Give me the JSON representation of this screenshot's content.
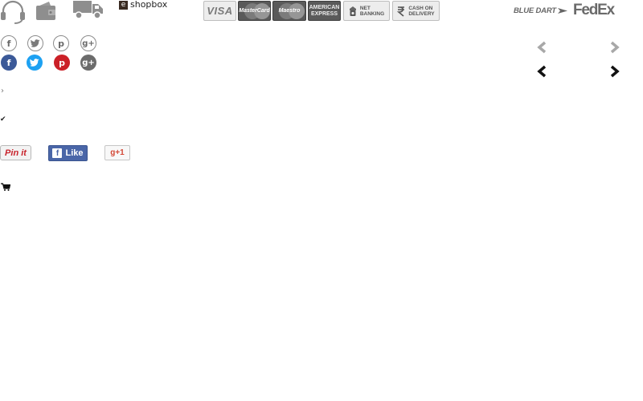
{
  "services": {
    "support_icon": "headset-icon",
    "wallet_icon": "wallet-icon",
    "delivery_icon": "delivery-truck-icon",
    "shopbox_badge": "e",
    "shopbox_label": "shopbox"
  },
  "payments": {
    "visa": "VISA",
    "mastercard": "MasterCard",
    "maestro": "Maestro",
    "amex_line1": "AMERICAN",
    "amex_line2": "EXPRESS",
    "netbanking_line1": "NET",
    "netbanking_line2": "BANKING",
    "cod_line1": "CASH ON",
    "cod_line2": "DELIVERY"
  },
  "couriers": {
    "bluedart": "BLUE DART",
    "fedex": "FedEx"
  },
  "social": {
    "facebook": "f",
    "twitter": "twitter-icon",
    "pinterest": "p",
    "googleplus": "g+",
    "colors": {
      "facebook": "#3b5998",
      "twitter": "#1da1f2",
      "pinterest": "#cb2027",
      "googleplus": "#6b6b6b"
    }
  },
  "breadcrumb_sep": "›",
  "check_mark": "✔",
  "share": {
    "pinit": "Pin it",
    "fb_badge": "f",
    "fb_like": "Like",
    "gplus": "g+1"
  },
  "cart_icon": "cart-icon"
}
